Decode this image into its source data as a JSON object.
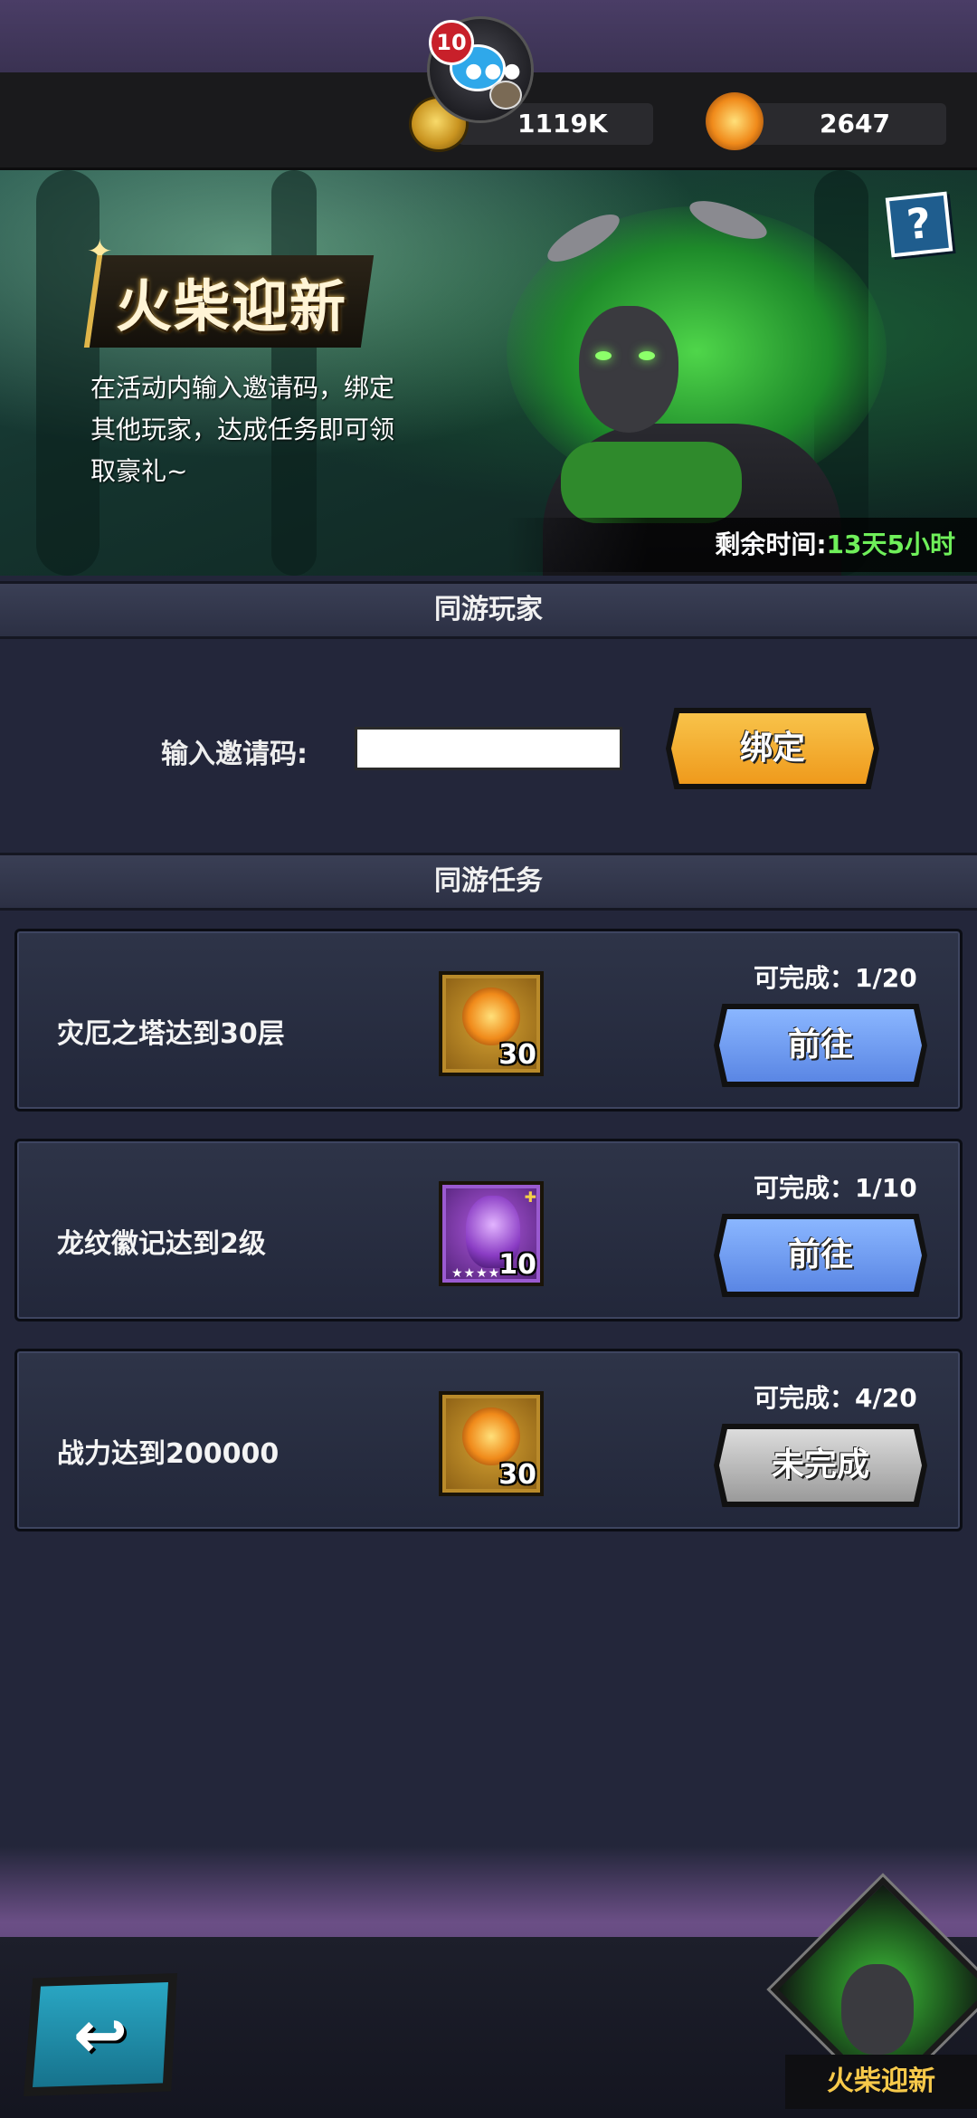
{
  "header": {
    "chat_badge": "10",
    "gold_amount": "1119K",
    "tickets_amount": "2647"
  },
  "banner": {
    "title": "火柴迎新",
    "description": "在活动内输入邀请码，绑定其他玩家，达成任务即可领取豪礼~",
    "help_label": "?",
    "time_label": "剩余时间:",
    "time_value": "13天5小时"
  },
  "invite": {
    "section_title": "同游玩家",
    "label": "输入邀请码:",
    "input_value": "",
    "input_placeholder": "",
    "bind_button": "绑定"
  },
  "tasks": {
    "section_title": "同游任务",
    "items": [
      {
        "name": "灾厄之塔达到30层",
        "reward_count": "30",
        "progress": "可完成：1/20",
        "button": "前往",
        "button_state": "go"
      },
      {
        "name": "龙纹徽记达到2级",
        "reward_count": "10",
        "progress": "可完成：1/10",
        "button": "前往",
        "button_state": "go"
      },
      {
        "name": "战力达到200000",
        "reward_count": "30",
        "progress": "可完成：4/20",
        "button": "未完成",
        "button_state": "incomplete"
      }
    ]
  },
  "footer": {
    "back_label": "↩",
    "event_label": "火柴迎新"
  },
  "icons": {
    "gold": "gold-coin-icon",
    "ticket": "flame-ticket-icon",
    "chat": "chat-bubble-icon",
    "help": "help-icon",
    "back": "back-arrow-icon"
  },
  "colors": {
    "accent_gold": "#ef9a1c",
    "accent_blue": "#5a86e4",
    "time_green": "#6ff05a",
    "event_label": "#f7c94a"
  }
}
